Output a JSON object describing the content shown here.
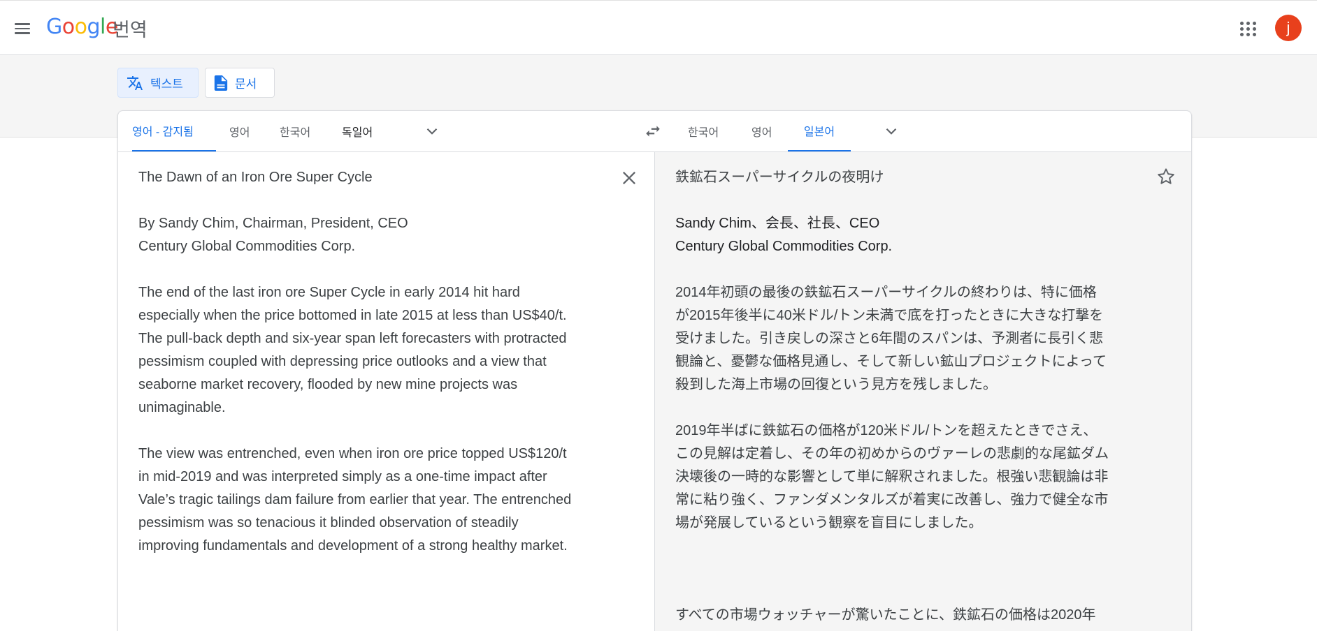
{
  "app": {
    "logo_text": "Google",
    "product_name": "번역",
    "avatar_initial": "j"
  },
  "modes": {
    "text_label": "텍스트",
    "document_label": "문서"
  },
  "source_languages": {
    "tabs": [
      "영어 - 감지됨",
      "영어",
      "한국어",
      "독일어"
    ],
    "active_index": 0
  },
  "target_languages": {
    "tabs": [
      "한국어",
      "영어",
      "일본어"
    ],
    "active_index": 2
  },
  "source_text": {
    "p1": "The Dawn of an Iron Ore Super Cycle",
    "p2": "By Sandy Chim, Chairman, President, CEO\nCentury Global Commodities Corp.",
    "p3": "The end of the last iron ore Super Cycle in early 2014 hit hard\nespecially when the price bottomed in late 2015 at less than US$40/t.\nThe pull-back depth and six-year span left forecasters with protracted\npessimism coupled with depressing price outlooks and a view that\nseaborne market recovery, flooded by new mine projects was\nunimaginable.",
    "p4": "The view was entrenched, even when iron ore price topped US$120/t\nin mid-2019 and was interpreted simply as a one-time impact after\nVale’s tragic tailings dam failure from earlier that year. The entrenched\npessimism was so tenacious it blinded observation of steadily\nimproving fundamentals and development of a strong healthy market."
  },
  "translated_text": {
    "p1": "鉄鉱石スーパーサイクルの夜明け",
    "p2": "Sandy Chim、会長、社長、CEO\nCentury Global Commodities Corp.",
    "p3": "2014年初頭の最後の鉄鉱石スーパーサイクルの終わりは、特に価格\nが2015年後半に40米ドル/トン未満で底を打ったときに大きな打撃を\n受けました。引き戻しの深さと6年間のスパンは、予測者に長引く悲\n観論と、憂鬱な価格見通し、そして新しい鉱山プロジェクトによって\n殺到した海上市場の回復という見方を残しました。",
    "p4": "2019年半ばに鉄鉱石の価格が120米ドル/トンを超えたときでさえ、\nこの見解は定着し、その年の初めからのヴァーレの悲劇的な尾鉱ダム\n決壊後の一時的な影響として単に解釈されました。根強い悲観論は非\n常に粘り強く、ファンダメンタルズが着実に改善し、強力で健全な市\n場が発展しているという観察を盲目にしました。",
    "p5": "すべての市場ウォッチャーが驚いたことに、鉄鉱石の価格は2020年"
  },
  "colors": {
    "accent": "#1a73e8",
    "avatar": "#e8401c",
    "target_bg": "#f5f5f5"
  }
}
